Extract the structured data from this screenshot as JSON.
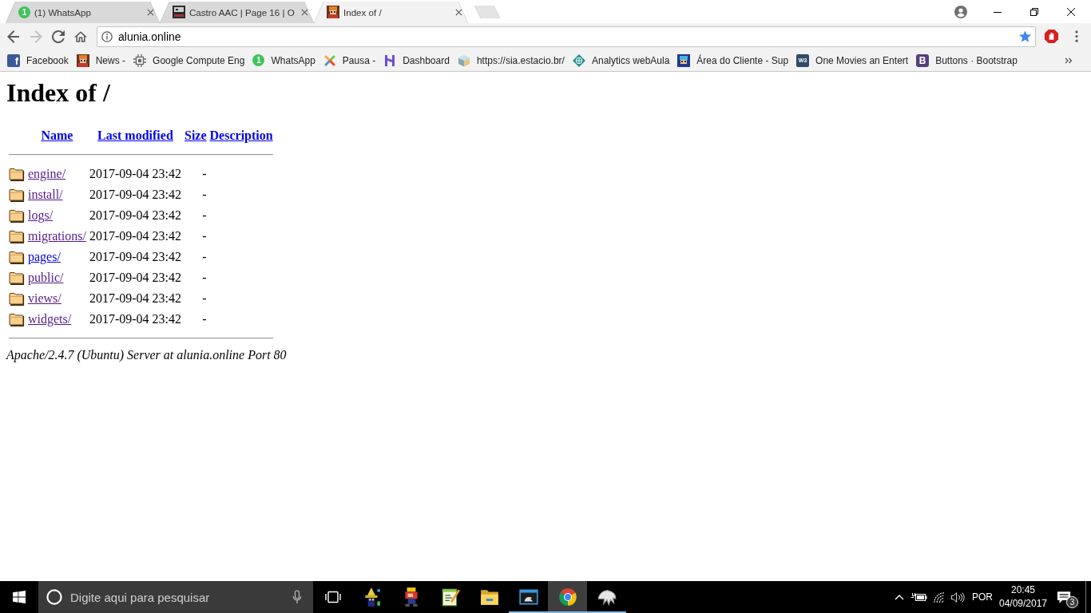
{
  "browser": {
    "tabs": [
      {
        "title": "(1) WhatsApp",
        "favicon_text": "1",
        "selected": false
      },
      {
        "title": "Castro AAC | Page 16 | O",
        "selected": false
      },
      {
        "title": "Index of /",
        "selected": true
      }
    ],
    "nav": {
      "back_disabled": false,
      "forward_disabled": true
    },
    "address_bar": {
      "url": "alunia.online",
      "bookmarked": true
    },
    "bookmarks": [
      {
        "label": "Facebook",
        "icon_text": "f"
      },
      {
        "label": "News -"
      },
      {
        "label": "Google Compute Eng"
      },
      {
        "label": "WhatsApp",
        "icon_text": "1"
      },
      {
        "label": "Pausa -"
      },
      {
        "label": "Dashboard"
      },
      {
        "label": "https://sia.estacio.br/"
      },
      {
        "label": "Analytics webAula"
      },
      {
        "label": "Área do Cliente - Sup"
      },
      {
        "label": "One Movies an Entert",
        "icon_text": "W3"
      },
      {
        "label": "Buttons · Bootstrap",
        "icon_text": "B"
      }
    ]
  },
  "page": {
    "heading": "Index of /",
    "table": {
      "columns": [
        "Name",
        "Last modified",
        "Size",
        "Description"
      ],
      "rows": [
        {
          "name": "engine/",
          "last_modified": "2017-09-04 23:42",
          "size": "-",
          "visited": true
        },
        {
          "name": "install/",
          "last_modified": "2017-09-04 23:42",
          "size": "-",
          "visited": true
        },
        {
          "name": "logs/",
          "last_modified": "2017-09-04 23:42",
          "size": "-",
          "visited": true
        },
        {
          "name": "migrations/",
          "last_modified": "2017-09-04 23:42",
          "size": "-",
          "visited": true
        },
        {
          "name": "pages/",
          "last_modified": "2017-09-04 23:42",
          "size": "-",
          "visited": false
        },
        {
          "name": "public/",
          "last_modified": "2017-09-04 23:42",
          "size": "-",
          "visited": true
        },
        {
          "name": "views/",
          "last_modified": "2017-09-04 23:42",
          "size": "-",
          "visited": true
        },
        {
          "name": "widgets/",
          "last_modified": "2017-09-04 23:42",
          "size": "-",
          "visited": true
        }
      ]
    },
    "footer": "Apache/2.4.7 (Ubuntu) Server at alunia.online Port 80"
  },
  "taskbar": {
    "search": {
      "placeholder": "Digite aqui para pesquisar"
    },
    "apps": [
      {
        "running": false,
        "selected": false
      },
      {
        "running": false,
        "selected": false
      },
      {
        "running": false,
        "selected": false
      },
      {
        "running": false,
        "selected": false
      },
      {
        "running": true,
        "selected": false
      },
      {
        "running": true,
        "selected": true
      },
      {
        "running": true,
        "selected": false
      }
    ],
    "tray": {
      "language": "POR",
      "time": "20:45",
      "date": "04/09/2017",
      "notification_count": "3"
    }
  }
}
